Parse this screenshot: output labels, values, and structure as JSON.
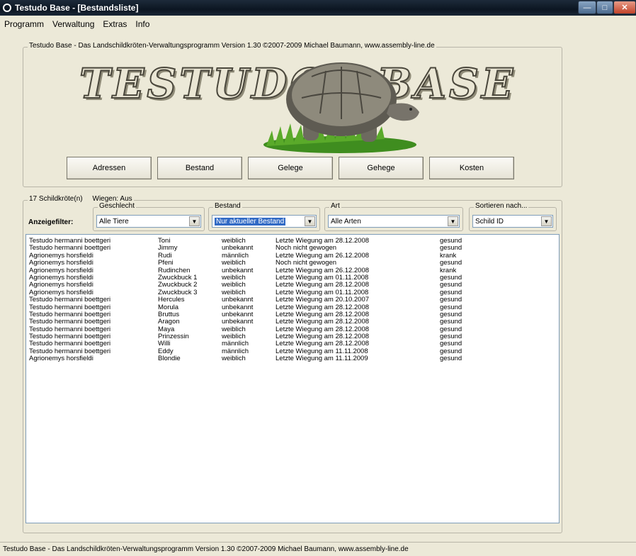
{
  "window": {
    "title": "Testudo Base - [Bestandsliste]",
    "controls": [
      "minimize-icon",
      "maximize-icon",
      "close-icon"
    ]
  },
  "menu": [
    "Programm",
    "Verwaltung",
    "Extras",
    "Info"
  ],
  "header_group": {
    "legend": "Testudo Base - Das Landschildkröten-Verwaltungsprogramm Version 1.30 ©2007-2009 Michael Baumann, www.assembly-line.de",
    "logo_left": "TESTUDO",
    "logo_right": "BASE"
  },
  "nav_buttons": [
    "Adressen",
    "Bestand",
    "Gelege",
    "Gehege",
    "Kosten"
  ],
  "list_group": {
    "legend_count": "17 Schildkröte(n)",
    "legend_wiegen": "Wiegen: Aus"
  },
  "filters": {
    "label": "Anzeigefilter:",
    "geschlecht": {
      "legend": "Geschlecht",
      "value": "Alle Tiere"
    },
    "bestand": {
      "legend": "Bestand",
      "value": "Nur aktueller Bestand"
    },
    "art": {
      "legend": "Art",
      "value": "Alle Arten"
    },
    "sortieren": {
      "legend": "Sortieren nach...",
      "value": "Schild ID"
    }
  },
  "rows": [
    [
      "Testudo hermanni boettgeri",
      "Toni",
      "weiblich",
      "Letzte Wiegung am 28.12.2008",
      "gesund"
    ],
    [
      "Testudo hermanni boettgeri",
      "Jimmy",
      "unbekannt",
      "Noch nicht gewogen",
      "gesund"
    ],
    [
      "Agrionemys horsfieldi",
      "Rudi",
      "männlich",
      "Letzte Wiegung am 26.12.2008",
      "krank"
    ],
    [
      "Agrionemys horsfieldi",
      "Pfeni",
      "weiblich",
      "Noch nicht gewogen",
      "gesund"
    ],
    [
      "Agrionemys horsfieldi",
      "Rudinchen",
      "unbekannt",
      "Letzte Wiegung am 26.12.2008",
      "krank"
    ],
    [
      "Agrionemys horsfieldi",
      "Zwuckbuck 1",
      "weiblich",
      "Letzte Wiegung am 01.11.2008",
      "gesund"
    ],
    [
      "Agrionemys horsfieldi",
      "Zwuckbuck 2",
      "weiblich",
      "Letzte Wiegung am 28.12.2008",
      "gesund"
    ],
    [
      "Agrionemys horsfieldi",
      "Zwuckbuck 3",
      "weiblich",
      "Letzte Wiegung am 01.11.2008",
      "gesund"
    ],
    [
      "Testudo hermanni boettgeri",
      "Hercules",
      "unbekannt",
      "Letzte Wiegung am 20.10.2007",
      "gesund"
    ],
    [
      "Testudo hermanni boettgeri",
      "Morula",
      "unbekannt",
      "Letzte Wiegung am 28.12.2008",
      "gesund"
    ],
    [
      "Testudo hermanni boettgeri",
      "Bruttus",
      "unbekannt",
      "Letzte Wiegung am 28.12.2008",
      "gesund"
    ],
    [
      "Testudo hermanni boettgeri",
      "Aragon",
      "unbekannt",
      "Letzte Wiegung am 28.12.2008",
      "gesund"
    ],
    [
      "Testudo hermanni boettgeri",
      "Maya",
      "weiblich",
      "Letzte Wiegung am 28.12.2008",
      "gesund"
    ],
    [
      "Testudo hermanni boettgeri",
      "Prinzessin",
      "weiblich",
      "Letzte Wiegung am 28.12.2008",
      "gesund"
    ],
    [
      "Testudo hermanni boettgeri",
      "Willi",
      "männlich",
      "Letzte Wiegung am 28.12.2008",
      "gesund"
    ],
    [
      "Testudo hermanni boettgeri",
      "Eddy",
      "männlich",
      "Letzte Wiegung am 11.11.2008",
      "gesund"
    ],
    [
      "Agrionemys horsfieldi",
      "Blondie",
      "weiblich",
      "Letzte Wiegung am 11.11.2009",
      "gesund"
    ]
  ],
  "statusbar": "Testudo Base - Das Landschildkröten-Verwaltungsprogramm Version 1.30 ©2007-2009 Michael Baumann, www.assembly-line.de"
}
